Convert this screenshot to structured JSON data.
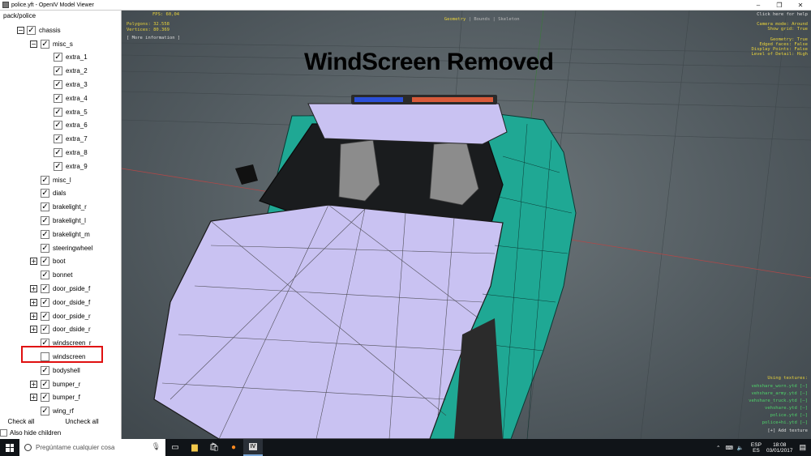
{
  "window": {
    "title": "police.yft - OpenIV Model Viewer",
    "minimize": "–",
    "maximize": "❐",
    "close": "✕"
  },
  "tree": {
    "root": "pack/police",
    "items": [
      {
        "label": "chassis",
        "level": 0,
        "expander": "minus",
        "checked": true
      },
      {
        "label": "misc_s",
        "level": 1,
        "expander": "minus",
        "checked": true
      },
      {
        "label": "extra_1",
        "level": 2,
        "expander": "none",
        "checked": true
      },
      {
        "label": "extra_2",
        "level": 2,
        "expander": "none",
        "checked": true
      },
      {
        "label": "extra_3",
        "level": 2,
        "expander": "none",
        "checked": true
      },
      {
        "label": "extra_4",
        "level": 2,
        "expander": "none",
        "checked": true
      },
      {
        "label": "extra_5",
        "level": 2,
        "expander": "none",
        "checked": true
      },
      {
        "label": "extra_6",
        "level": 2,
        "expander": "none",
        "checked": true
      },
      {
        "label": "extra_7",
        "level": 2,
        "expander": "none",
        "checked": true
      },
      {
        "label": "extra_8",
        "level": 2,
        "expander": "none",
        "checked": true
      },
      {
        "label": "extra_9",
        "level": 2,
        "expander": "none",
        "checked": true
      },
      {
        "label": "misc_l",
        "level": 1,
        "expander": "none",
        "checked": true
      },
      {
        "label": "dials",
        "level": 1,
        "expander": "none",
        "checked": true
      },
      {
        "label": "brakelight_r",
        "level": 1,
        "expander": "none",
        "checked": true
      },
      {
        "label": "brakelight_l",
        "level": 1,
        "expander": "none",
        "checked": true
      },
      {
        "label": "brakelight_m",
        "level": 1,
        "expander": "none",
        "checked": true
      },
      {
        "label": "steeringwheel",
        "level": 1,
        "expander": "none",
        "checked": true
      },
      {
        "label": "boot",
        "level": 1,
        "expander": "plus",
        "checked": true
      },
      {
        "label": "bonnet",
        "level": 1,
        "expander": "none",
        "checked": true
      },
      {
        "label": "door_pside_f",
        "level": 1,
        "expander": "plus",
        "checked": true
      },
      {
        "label": "door_dside_f",
        "level": 1,
        "expander": "plus",
        "checked": true
      },
      {
        "label": "door_pside_r",
        "level": 1,
        "expander": "plus",
        "checked": true
      },
      {
        "label": "door_dside_r",
        "level": 1,
        "expander": "plus",
        "checked": true
      },
      {
        "label": "windscreen_r",
        "level": 1,
        "expander": "none",
        "checked": true
      },
      {
        "label": "windscreen",
        "level": 1,
        "expander": "none",
        "checked": false
      },
      {
        "label": "bodyshell",
        "level": 1,
        "expander": "none",
        "checked": true
      },
      {
        "label": "bumper_r",
        "level": 1,
        "expander": "plus",
        "checked": true
      },
      {
        "label": "bumper_f",
        "level": 1,
        "expander": "plus",
        "checked": true
      },
      {
        "label": "wing_rf",
        "level": 1,
        "expander": "none",
        "checked": true
      }
    ],
    "check_all": "Check all",
    "uncheck_all": "Uncheck all",
    "also_hide_children": "Also hide children",
    "also_hide_checked": false
  },
  "viewport": {
    "overlay_title": "WindScreen Removed",
    "fps": "FPS: 60,04",
    "polygons": "Polygons: 32.558",
    "vertices": "Vertices: 80.369",
    "more_info": "[ More information ]",
    "modes": {
      "geometry": "Geometry",
      "sep1": " | ",
      "bounds": "Bounds",
      "sep2": " | ",
      "skeleton": "Skeleton"
    },
    "help": "Click here for help",
    "settings": [
      "Camera mode: Around",
      "Show grid: True",
      "",
      "Geometry: True",
      "Edged faces: False",
      "Display Points: False",
      "Level of Detail: High"
    ],
    "textures_header": "Using textures:",
    "textures": [
      "vehshare_worn.ytd [–]",
      "vehshare_army.ytd [–]",
      "vehshare_truck.ytd [–]",
      "vehshare.ytd [–]",
      "police.ytd [–]",
      "police+hi.ytd [–]"
    ],
    "add_texture": "[+] Add texture",
    "colors": {
      "hud_yellow": "#e8d23a",
      "hud_green": "#4fd36a",
      "body_teal": "#1fa894",
      "body_lavender": "#c9c2f2"
    }
  },
  "taskbar": {
    "search_placeholder": "Pregúntame cualquier cosa",
    "lang_top": "ESP",
    "lang_bottom": "ES",
    "time": "18:08",
    "date": "03/01/2017",
    "icons": [
      "windows-start-icon",
      "task-view-icon",
      "file-explorer-icon",
      "store-icon",
      "firefox-icon",
      "openiv-icon"
    ]
  }
}
